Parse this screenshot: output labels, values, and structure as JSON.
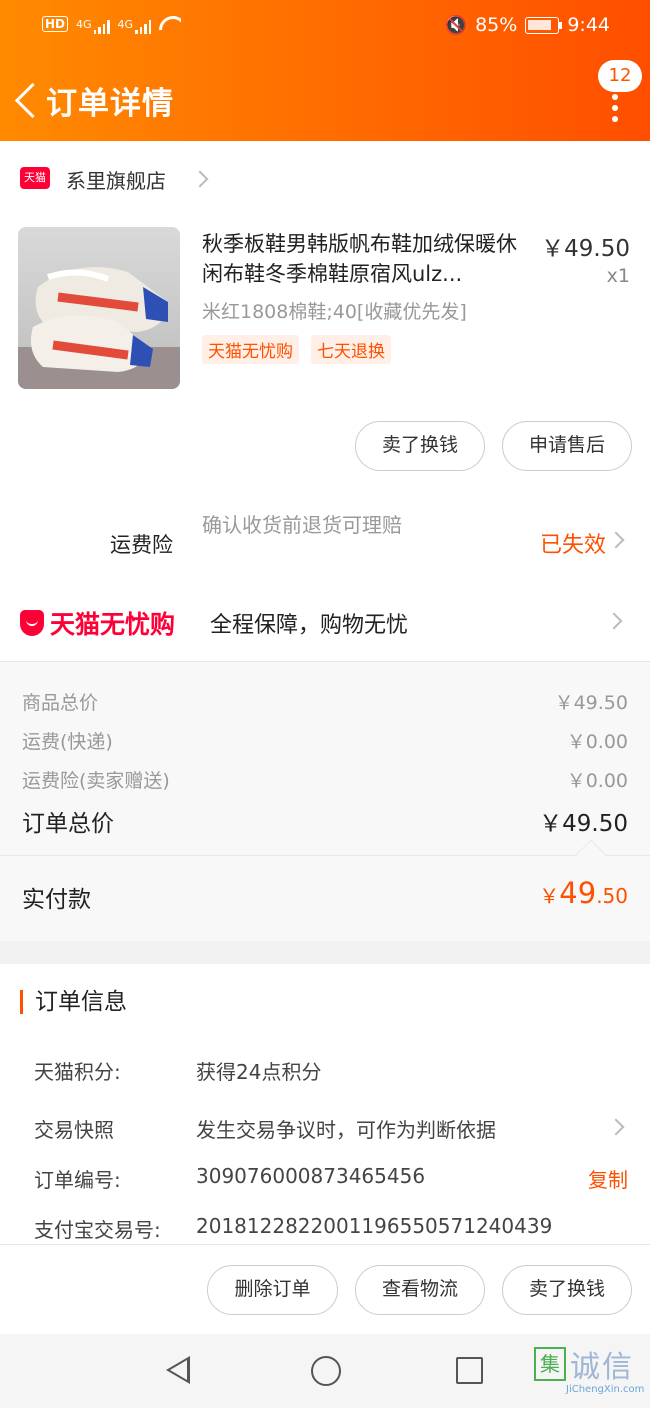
{
  "status_bar": {
    "hd": "HD",
    "sig1": "4G",
    "sig2": "4G",
    "battery": "85%",
    "battery_level": 0.85,
    "time": "9:44"
  },
  "header": {
    "title": "订单详情",
    "badge_count": "12"
  },
  "store": {
    "badge": "天猫",
    "name": "系里旗舰店"
  },
  "product": {
    "title": "秋季板鞋男韩版帆布鞋加绒保暖休闲布鞋冬季棉鞋原宿风ulz...",
    "price": "￥49.50",
    "qty": "x1",
    "sku": "米红1808棉鞋;40[收藏优先发]",
    "tags": [
      "天猫无忧购",
      "七天退换"
    ]
  },
  "item_actions": {
    "sell_label": "卖了换钱",
    "aftersale_label": "申请售后"
  },
  "insurance": {
    "label": "运费险",
    "desc": "确认收货前退货可理赔",
    "status": "已失效"
  },
  "assurance": {
    "logo": "天猫无忧购",
    "text": "全程保障，购物无忧"
  },
  "summary": {
    "rows": [
      {
        "label": "商品总价",
        "value": "￥49.50"
      },
      {
        "label": "运费(快递)",
        "value": "￥0.00"
      },
      {
        "label": "运费险(卖家赠送)",
        "value": "￥0.00"
      }
    ],
    "total_label": "订单总价",
    "total_value": "￥49.50"
  },
  "payment": {
    "label": "实付款",
    "symbol": "￥",
    "int": "49",
    "dec": ".50"
  },
  "order_info": {
    "heading": "订单信息",
    "rows": [
      {
        "key": "天猫积分:",
        "value": "获得24点积分"
      },
      {
        "key": "交易快照",
        "value": "发生交易争议时，可作为判断依据"
      },
      {
        "key": "订单编号:",
        "value": "309076000873465456"
      },
      {
        "key": "支付宝交易号:",
        "value": "2018122822001196550571240439"
      }
    ],
    "copy_label": "复制"
  },
  "bottom_actions": {
    "delete_label": "删除订单",
    "logistics_label": "查看物流",
    "sell_label": "卖了换钱"
  },
  "watermark": {
    "box": "集",
    "text": "诚信",
    "url": "JiChengXin.com"
  }
}
